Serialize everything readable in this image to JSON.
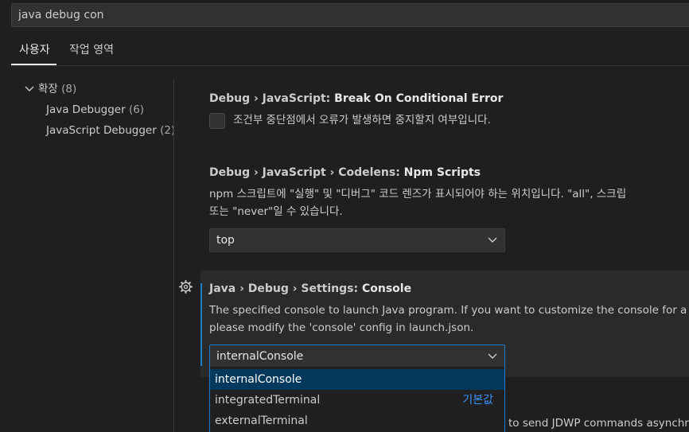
{
  "search": {
    "value": "java debug con"
  },
  "tabs": [
    {
      "label": "사용자"
    },
    {
      "label": "작업 영역"
    }
  ],
  "toc": {
    "group": {
      "label": "확장",
      "count": "(8)"
    },
    "items": [
      {
        "label": "Java Debugger",
        "count": "(6)"
      },
      {
        "label": "JavaScript Debugger",
        "count": "(2)"
      }
    ]
  },
  "settings": [
    {
      "category": "Debug › JavaScript: ",
      "name": "Break On Conditional Error",
      "description": "조건부 중단점에서 오류가 발생하면 중지할지 여부입니다.",
      "checked": false
    },
    {
      "category": "Debug › JavaScript › Codelens: ",
      "name": "Npm Scripts",
      "description_line1": "npm 스크립트에 \"실행\" 및 \"디버그\" 코드 렌즈가 표시되어야 하는 위치입니다. \"all\", 스크립",
      "description_line2": "또는 \"never\"일 수 있습니다.",
      "value": "top"
    },
    {
      "category": "Java › Debug › Settings: ",
      "name": "Console",
      "description_line1": "The specified console to launch Java program. If you want to customize the console for a sp",
      "description_line2": "please modify the 'console' config in launch.json.",
      "value": "internalConsole",
      "options": [
        {
          "label": "internalConsole",
          "selected": true,
          "tag": ""
        },
        {
          "label": "integratedTerminal",
          "selected": false,
          "tag": "기본값"
        },
        {
          "label": "externalTerminal",
          "selected": false,
          "tag": ""
        }
      ]
    }
  ],
  "partial_text": "to send JDWP commands asynchr",
  "colors": {
    "accent": "#1f7bd0",
    "selected_option": "#04395e",
    "default_tag": "#3794ff"
  }
}
